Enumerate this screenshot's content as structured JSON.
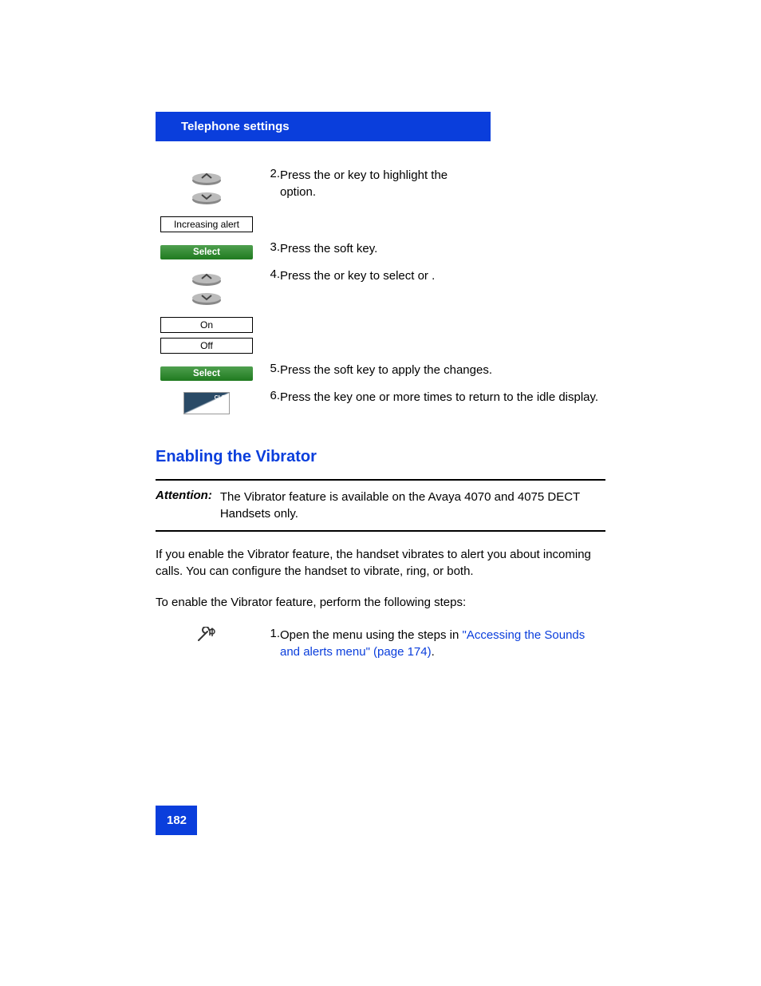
{
  "header": "Telephone settings",
  "steps": {
    "s2": {
      "num": "2.",
      "text_a": "Press the ",
      "text_b": " or ",
      "text_c": " key to highlight the ",
      "text_d": " option."
    },
    "increasing_alert": "Increasing alert",
    "select1": "Select",
    "s3": {
      "num": "3.",
      "text_a": "Press the ",
      "text_b": " soft key."
    },
    "s4": {
      "num": "4.",
      "text_a": "Press the ",
      "text_b": " or ",
      "text_c": " key to select ",
      "text_d": " or ",
      "text_e": "."
    },
    "on": "On",
    "off": "Off",
    "select2": "Select",
    "s5": {
      "num": "5.",
      "text_a": "Press the ",
      "text_b": " soft key to apply the changes."
    },
    "s6": {
      "num": "6.",
      "text_a": "Press the ",
      "text_b": " key one or more times to return to the idle display."
    }
  },
  "section_title": "Enabling the Vibrator",
  "attention": {
    "label": "Attention:",
    "text": "The Vibrator feature is available on the Avaya 4070 and 4075 DECT Handsets only."
  },
  "para1": "If you enable the Vibrator feature, the handset vibrates to alert you about incoming calls. You can configure the handset to vibrate, ring, or both.",
  "para2": "To enable the Vibrator feature, perform the following steps:",
  "vib_step1": {
    "num": "1.",
    "text_a": "Open the ",
    "text_b": " menu using the steps in ",
    "link": "\"Accessing the Sounds and alerts menu\" (page 174)",
    "text_c": "."
  },
  "page_number": "182"
}
